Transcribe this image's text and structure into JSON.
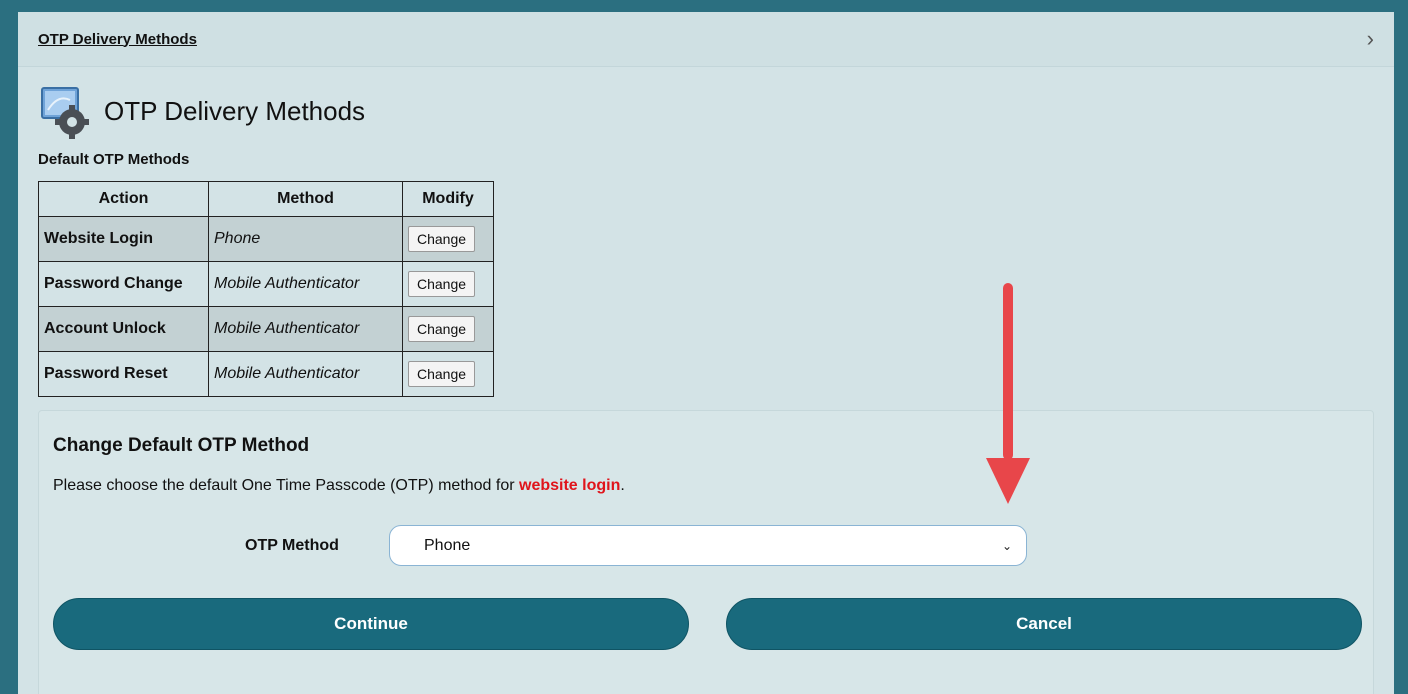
{
  "header": {
    "breadcrumb": "OTP Delivery Methods"
  },
  "page_title": "OTP Delivery Methods",
  "section_label": "Default OTP Methods",
  "table": {
    "columns": [
      "Action",
      "Method",
      "Modify"
    ],
    "rows": [
      {
        "action": "Website Login",
        "method": "Phone",
        "button": "Change"
      },
      {
        "action": "Password Change",
        "method": "Mobile Authenticator",
        "button": "Change"
      },
      {
        "action": "Account Unlock",
        "method": "Mobile Authenticator",
        "button": "Change"
      },
      {
        "action": "Password Reset",
        "method": "Mobile Authenticator",
        "button": "Change"
      }
    ]
  },
  "panel": {
    "title": "Change Default OTP Method",
    "description_prefix": "Please choose the default One Time Passcode (OTP) method for ",
    "description_highlight": "website login",
    "description_suffix": ".",
    "otp_label": "OTP Method",
    "otp_selected": "Phone",
    "continue_label": "Continue",
    "cancel_label": "Cancel"
  },
  "colors": {
    "accent": "#196a7d",
    "highlight": "#e0141b",
    "annotation_arrow": "#e8464a"
  },
  "icons": [
    "chevron-right-icon",
    "settings-app-icon",
    "chevron-down-icon",
    "annotation-arrow-icon"
  ]
}
